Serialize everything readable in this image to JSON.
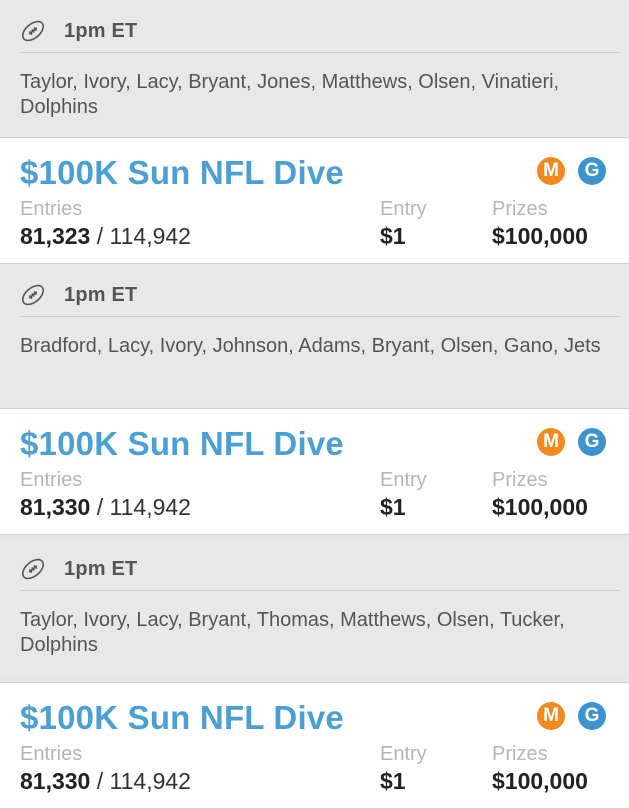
{
  "groups": [
    {
      "time": "1pm ET",
      "players": "Taylor, Ivory, Lacy, Bryant, Jones, Matthews, Olsen, Vinatieri, Dolphins",
      "contest": {
        "name": "$100K Sun NFL Dive",
        "badge_m": "M",
        "badge_g": "G",
        "entries_label": "Entries",
        "entries_count": "81,323",
        "entries_sep": " / ",
        "entries_max": "114,942",
        "entry_label": "Entry",
        "entry_fee": "$1",
        "prizes_label": "Prizes",
        "prizes_value": "$100,000"
      }
    },
    {
      "time": "1pm ET",
      "players": "Bradford, Lacy, Ivory, Johnson, Adams, Bryant, Olsen, Gano, Jets",
      "contest": {
        "name": "$100K Sun NFL Dive",
        "badge_m": "M",
        "badge_g": "G",
        "entries_label": "Entries",
        "entries_count": "81,330",
        "entries_sep": " / ",
        "entries_max": "114,942",
        "entry_label": "Entry",
        "entry_fee": "$1",
        "prizes_label": "Prizes",
        "prizes_value": "$100,000"
      }
    },
    {
      "time": "1pm ET",
      "players": "Taylor, Ivory, Lacy, Bryant, Thomas, Matthews, Olsen, Tucker, Dolphins",
      "contest": {
        "name": "$100K Sun NFL Dive",
        "badge_m": "M",
        "badge_g": "G",
        "entries_label": "Entries",
        "entries_count": "81,330",
        "entries_sep": " / ",
        "entries_max": "114,942",
        "entry_label": "Entry",
        "entry_fee": "$1",
        "prizes_label": "Prizes",
        "prizes_value": "$100,000"
      }
    }
  ],
  "icons": {
    "sport": "football-icon"
  },
  "colors": {
    "contest_title": "#4a9fd4",
    "badge_m": "#f08a1f",
    "badge_g": "#3d93cf"
  }
}
